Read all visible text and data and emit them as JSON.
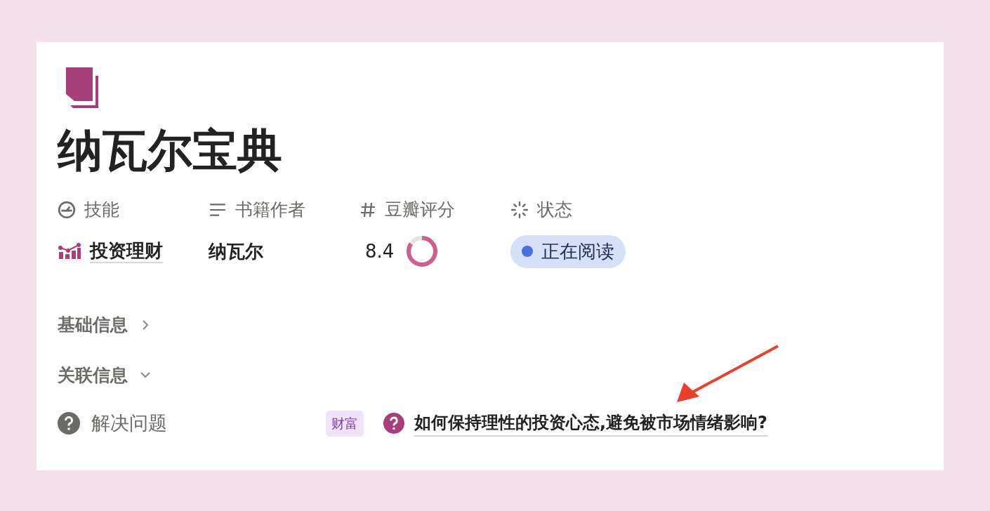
{
  "page": {
    "title": "纳瓦尔宝典"
  },
  "properties": [
    {
      "kind": "relation",
      "label": "技能",
      "value": "投资理财"
    },
    {
      "kind": "text",
      "label": "书籍作者",
      "value": "纳瓦尔"
    },
    {
      "kind": "rating",
      "label": "豆瓣评分",
      "value": "8.4",
      "level": 0.84
    },
    {
      "kind": "status",
      "label": "状态",
      "value": "正在阅读",
      "color": "#4a6fe0"
    }
  ],
  "sections": [
    {
      "label": "基础信息",
      "expanded": false
    },
    {
      "label": "关联信息",
      "expanded": true
    }
  ],
  "relations": [
    {
      "label": "解决问题",
      "tag": "财富",
      "value": "如何保持理性的投资心态,避免被市场情绪影响?"
    }
  ]
}
